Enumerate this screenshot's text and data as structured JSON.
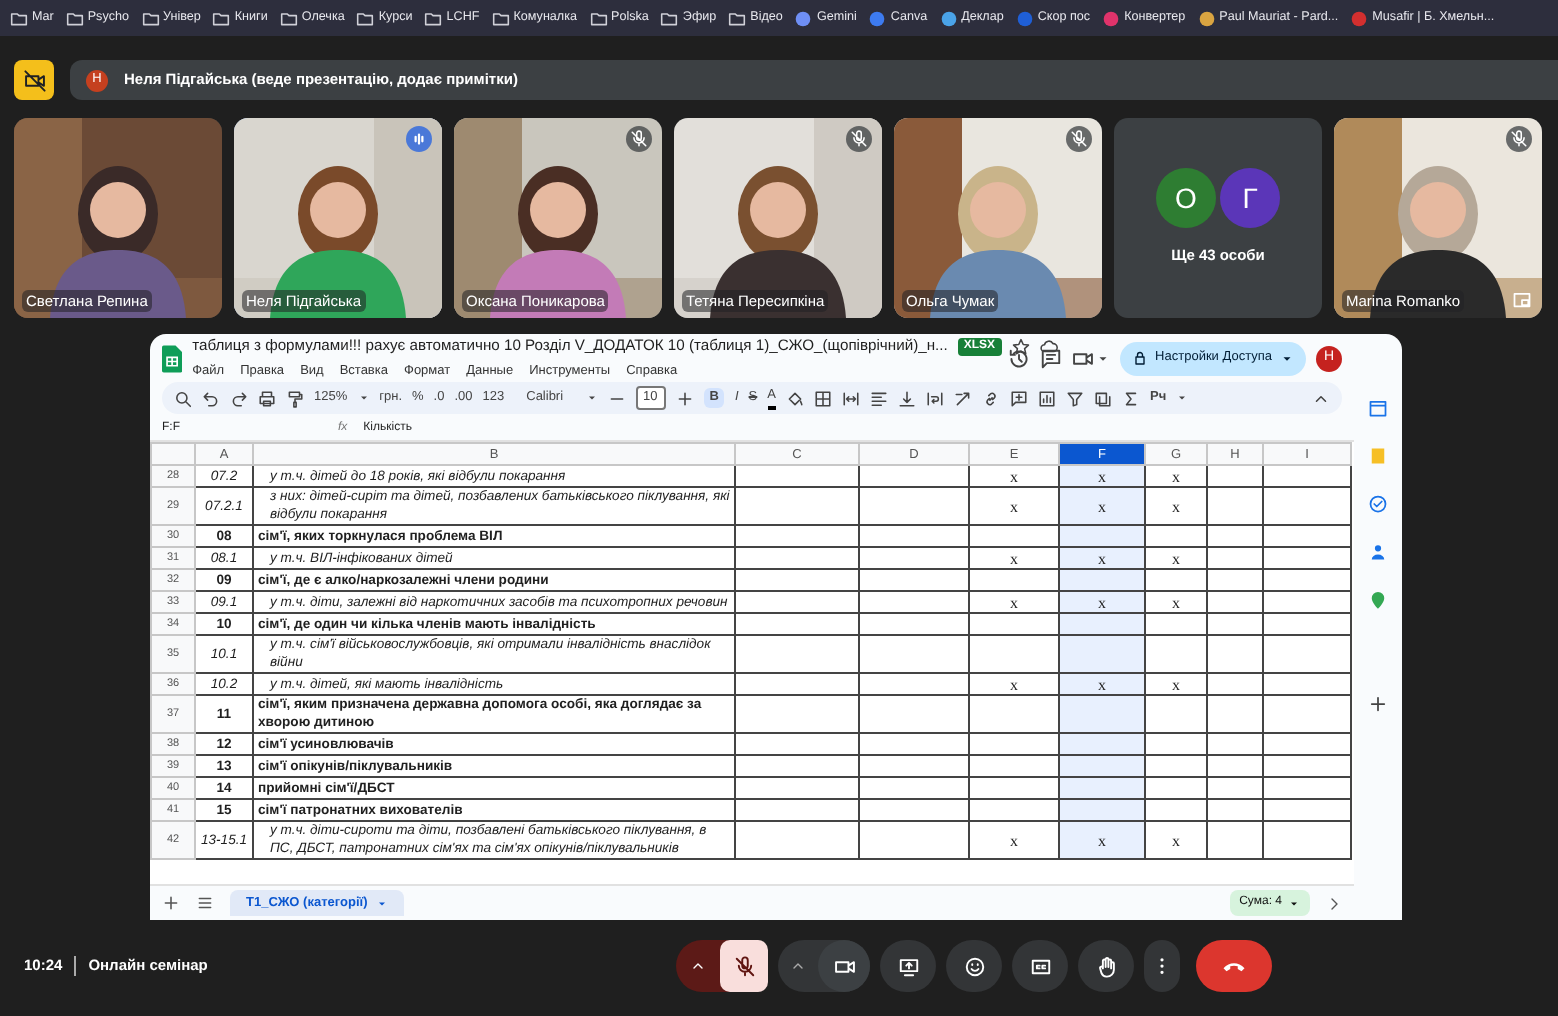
{
  "bookmarks": [
    {
      "label": "Mar",
      "kind": "folder"
    },
    {
      "label": "Psycho",
      "kind": "folder"
    },
    {
      "label": "Універ",
      "kind": "folder"
    },
    {
      "label": "Книги",
      "kind": "folder"
    },
    {
      "label": "Олечка",
      "kind": "folder"
    },
    {
      "label": "Курси",
      "kind": "folder"
    },
    {
      "label": "LCHF",
      "kind": "folder"
    },
    {
      "label": "Комуналка",
      "kind": "folder"
    },
    {
      "label": "Polska",
      "kind": "folder"
    },
    {
      "label": "Эфир",
      "kind": "folder"
    },
    {
      "label": "Відео",
      "kind": "folder"
    },
    {
      "label": "Gemini",
      "kind": "site",
      "color": "#6f8ff5"
    },
    {
      "label": "Canva",
      "kind": "site",
      "color": "#3d7bf0"
    },
    {
      "label": "Деклар",
      "kind": "site",
      "color": "#4aa3e8"
    },
    {
      "label": "Скор пос",
      "kind": "site",
      "color": "#1f5fd6"
    },
    {
      "label": "Конвертер",
      "kind": "site",
      "color": "#e0336b"
    },
    {
      "label": "Paul Mauriat - Pard...",
      "kind": "site",
      "color": "#d9a441"
    },
    {
      "label": "Musafir | Б. Хмельн...",
      "kind": "site",
      "color": "#d32f2f"
    }
  ],
  "presenter": {
    "initial": "Н",
    "text": "Неля Підгайська (веде презентацію, додає примітки)"
  },
  "tiles": [
    {
      "kind": "video",
      "name": "Светлана Репина",
      "muted": false,
      "speaking": false
    },
    {
      "kind": "video",
      "name": "Неля Підгайська",
      "muted": false,
      "speaking": true
    },
    {
      "kind": "video",
      "name": "Оксана Поникарова",
      "muted": true,
      "speaking": false
    },
    {
      "kind": "video",
      "name": "Тетяна Пересипкіна",
      "muted": true,
      "speaking": false
    },
    {
      "kind": "video",
      "name": "Ольга Чумак",
      "muted": true,
      "speaking": false
    },
    {
      "kind": "more",
      "avatars": [
        {
          "initial": "О",
          "color": "#2e7d32"
        },
        {
          "initial": "Г",
          "color": "#5b36b8"
        }
      ],
      "label": "Ще 43 особи"
    },
    {
      "kind": "video",
      "name": "Marina Romanko",
      "muted": true,
      "speaking": false,
      "pinned": true
    }
  ],
  "sheet": {
    "title": "таблиця з формулами!!! рахує автоматично 10 Розділ V_ДОДАТОК 10 (таблиця 1)_СЖО_(щопіврічний)_н...",
    "badge": "XLSX",
    "menus": [
      "Файл",
      "Правка",
      "Вид",
      "Вставка",
      "Формат",
      "Данные",
      "Инструменты",
      "Справка"
    ],
    "share": "Настройки Доступа",
    "avatar": "Н",
    "toolbar": {
      "zoom": "125%",
      "currency": "грн.",
      "percent": "%",
      "dec_less": ".0",
      "dec_more": ".00",
      "number_format": "123",
      "font": "Calibri",
      "font_size": "10",
      "bold": "B",
      "bold_on": true,
      "italic": "I",
      "strike": "S",
      "text_color": "A",
      "input": "Рч"
    },
    "name_box": "F:F",
    "formula_label": "fx",
    "formula": "Кількість",
    "columns": [
      {
        "label": "A",
        "selected": false
      },
      {
        "label": "B",
        "selected": false
      },
      {
        "label": "C",
        "selected": false
      },
      {
        "label": "D",
        "selected": false
      },
      {
        "label": "E",
        "selected": false
      },
      {
        "label": "F",
        "selected": true
      },
      {
        "label": "G",
        "selected": false
      },
      {
        "label": "H",
        "selected": false
      },
      {
        "label": "I",
        "selected": false
      }
    ],
    "rows": [
      {
        "num": "28",
        "a": "07.2",
        "b": "у т.ч. дітей до 18 років, які відбули покарання",
        "kind": "subcategory",
        "e": "x",
        "f": "x",
        "g": "x"
      },
      {
        "num": "29",
        "a": "07.2.1",
        "b": "з них: дітей-сиріт та дітей, позбавлених батьківського піклування, які відбули покарання",
        "kind": "subcategory",
        "e": "x",
        "f": "x",
        "g": "x"
      },
      {
        "num": "30",
        "a": "08",
        "b": "сім'ї, яких торкнулася проблема ВІЛ",
        "kind": "category"
      },
      {
        "num": "31",
        "a": "08.1",
        "b": "у т.ч. ВІЛ-інфікованих дітей",
        "kind": "subcategory",
        "e": "x",
        "f": "x",
        "g": "x"
      },
      {
        "num": "32",
        "a": "09",
        "b": "сім'ї, де є алко/наркозалежні члени родини",
        "kind": "category"
      },
      {
        "num": "33",
        "a": "09.1",
        "b": "у т.ч. діти, залежні від наркотичних засобів та психотропних речовин",
        "kind": "subcategory",
        "e": "x",
        "f": "x",
        "g": "x"
      },
      {
        "num": "34",
        "a": "10",
        "b": "сім'ї, де один чи кілька членів мають інвалідність",
        "kind": "category"
      },
      {
        "num": "35",
        "a": "10.1",
        "b": "у т.ч. сім'ї військовослужбовців, які отримали інвалідність внаслідок війни",
        "kind": "subcategory"
      },
      {
        "num": "36",
        "a": "10.2",
        "b": "у т.ч. дітей, які мають інвалідність",
        "kind": "subcategory",
        "e": "x",
        "f": "x",
        "g": "x"
      },
      {
        "num": "37",
        "a": "11",
        "b": "сім'ї, яким призначена державна допомога особі, яка доглядає за хворою дитиною",
        "kind": "category"
      },
      {
        "num": "38",
        "a": "12",
        "b": "сім'ї усиновлювачів",
        "kind": "category"
      },
      {
        "num": "39",
        "a": "13",
        "b": "сім'ї опікунів/піклувальників",
        "kind": "category"
      },
      {
        "num": "40",
        "a": "14",
        "b": "прийомні сім'ї/ДБСТ",
        "kind": "category"
      },
      {
        "num": "41",
        "a": "15",
        "b": "сім'ї патронатних вихователів",
        "kind": "category"
      },
      {
        "num": "42",
        "a": "13-15.1",
        "b": "у т.ч. діти-сироти та діти, позбавлені батьківського піклування, в ПС, ДБСТ, патронатних сім'ях та сім'ях опікунів/піклувальників",
        "kind": "subcategory",
        "e": "x",
        "f": "x",
        "g": "x"
      }
    ],
    "tab": {
      "label": "Т1_СЖО (категорії)",
      "selected": true
    },
    "sum": "Сума: 4"
  },
  "meeting": {
    "time": "10:24",
    "title": "Онлайн семінар",
    "mic_muted": true
  }
}
